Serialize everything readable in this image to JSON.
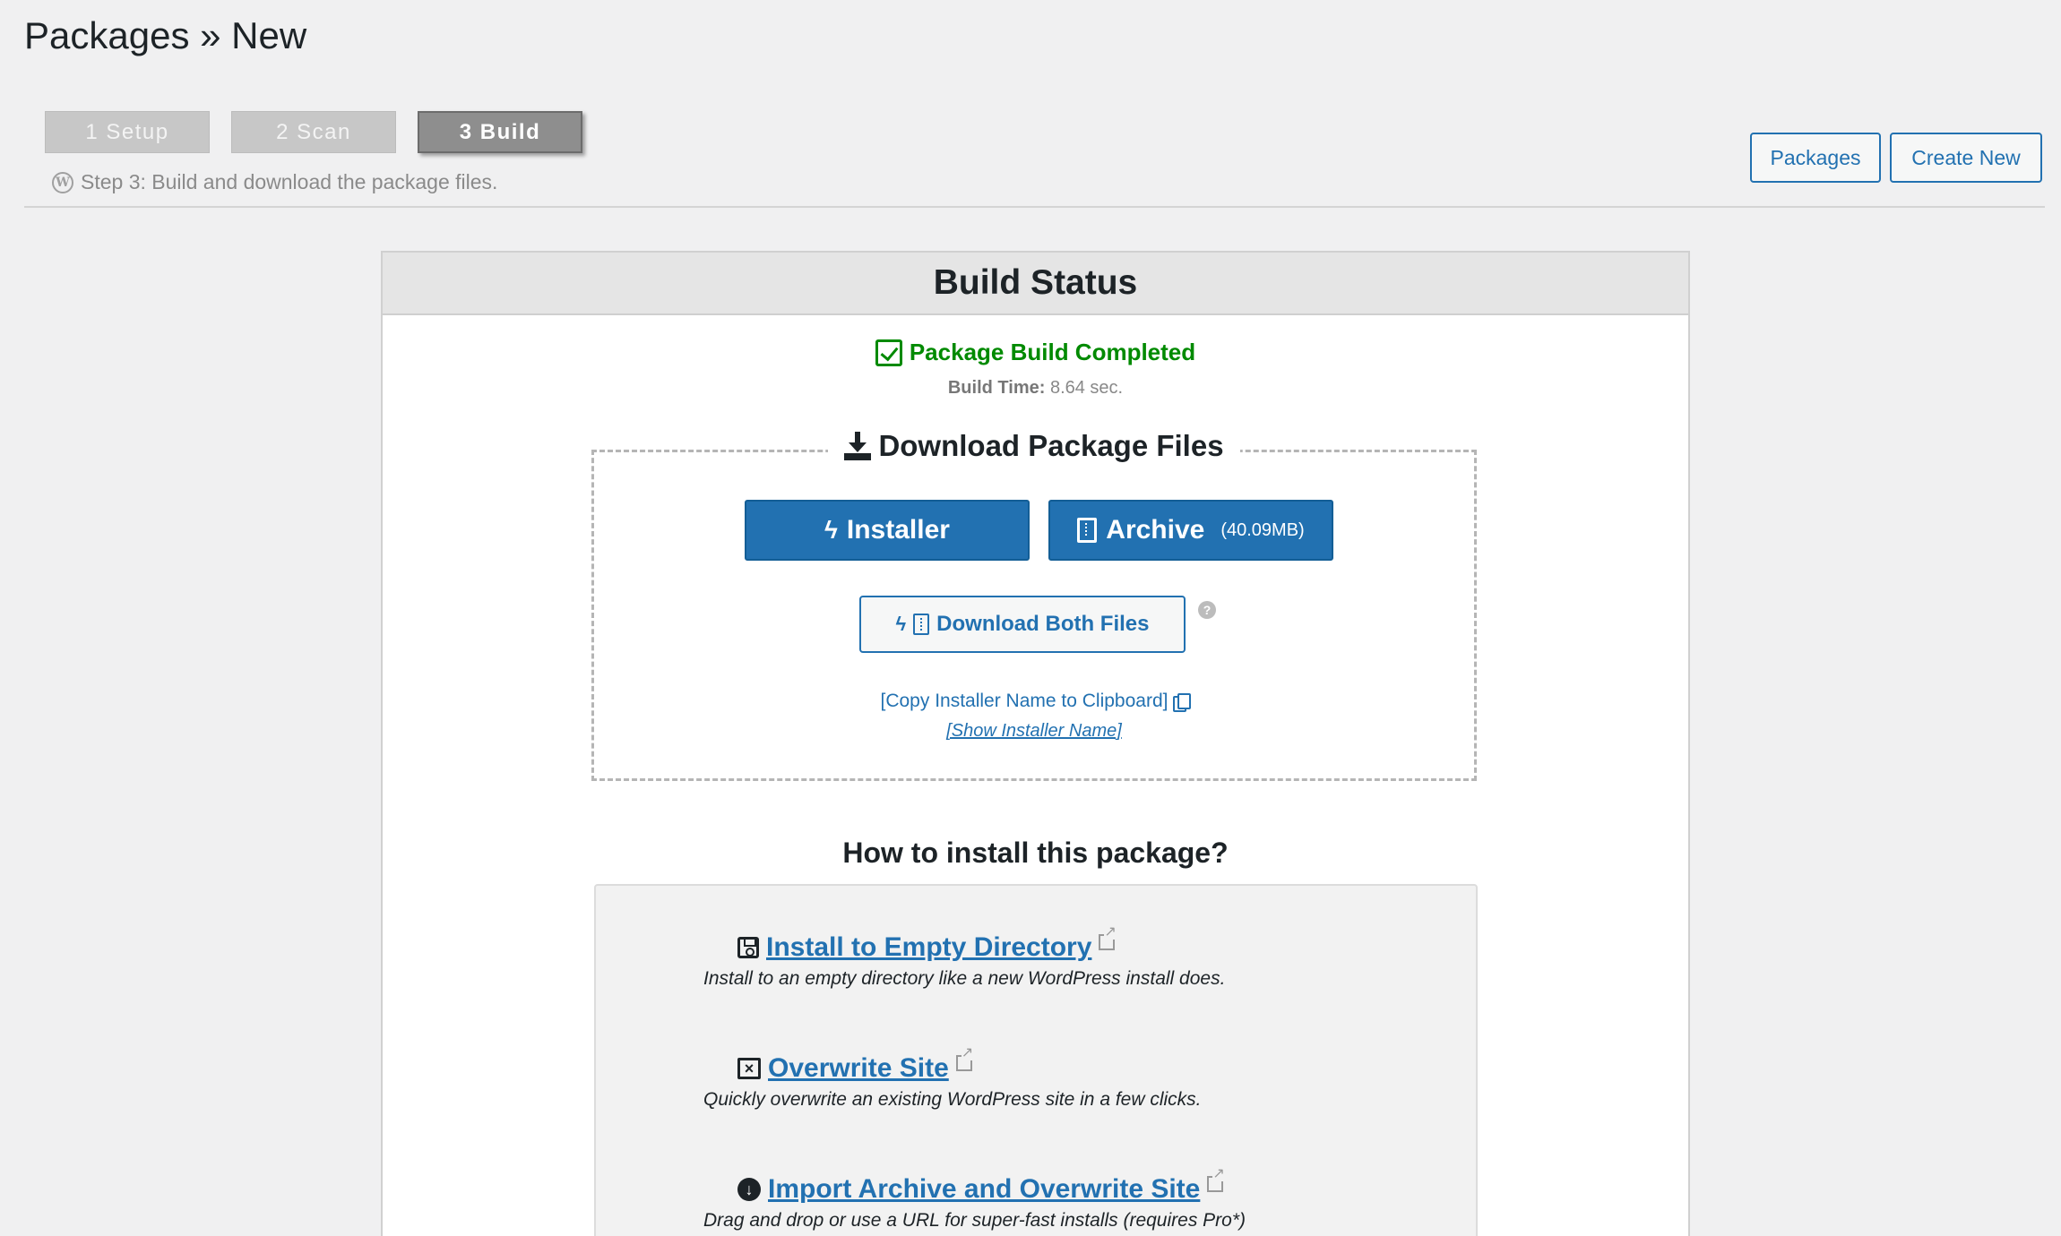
{
  "page": {
    "title": "Packages » New"
  },
  "steps": [
    {
      "label": "1 Setup"
    },
    {
      "label": "2 Scan"
    },
    {
      "label": "3 Build"
    }
  ],
  "step_description": "Step 3: Build and download the package files.",
  "top_buttons": {
    "packages": "Packages",
    "create_new": "Create New"
  },
  "panel": {
    "title": "Build Status",
    "status": "Package Build Completed",
    "build_time_label": "Build Time:",
    "build_time_value": "8.64 sec."
  },
  "download": {
    "legend": "Download Package Files",
    "installer_label": "Installer",
    "archive_label": "Archive",
    "archive_size": "(40.09MB)",
    "both_label": "Download Both Files",
    "help": "?",
    "copy_link": "[Copy Installer Name to Clipboard]",
    "show_link": "[Show Installer Name]"
  },
  "install": {
    "title": "How to install this package?",
    "options": [
      {
        "label": "Install to Empty Directory",
        "desc": "Install to an empty directory like a new WordPress install does.",
        "icon": "floppy-icon"
      },
      {
        "label": "Overwrite Site",
        "desc": "Quickly overwrite an existing WordPress site in a few clicks.",
        "icon": "x-square-icon"
      },
      {
        "label": "Import Archive and Overwrite Site",
        "desc": "Drag and drop or use a URL for super-fast installs (requires Pro*)",
        "icon": "download-circle-icon"
      }
    ]
  },
  "colors": {
    "accent": "#2271b1",
    "success": "#008a00",
    "background": "#f0f0f1"
  }
}
